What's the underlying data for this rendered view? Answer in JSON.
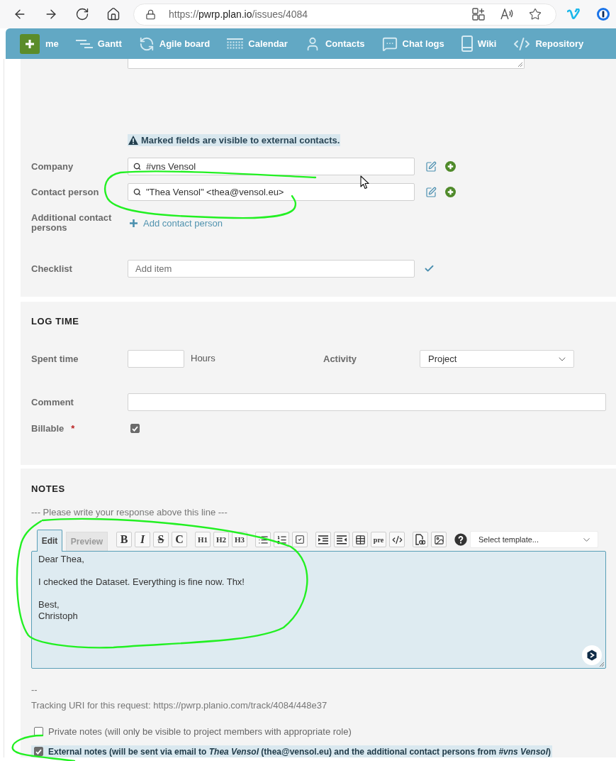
{
  "browser": {
    "address": {
      "scheme": "https://",
      "host": "pwrp.plan.io",
      "path": "/issues/4084"
    }
  },
  "nav": {
    "items": [
      {
        "label": "me",
        "kind": "home"
      },
      {
        "label": "Gantt",
        "kind": "gantt"
      },
      {
        "label": "Agile board",
        "kind": "agile"
      },
      {
        "label": "Calendar",
        "kind": "calendar"
      },
      {
        "label": "Contacts",
        "kind": "contacts"
      },
      {
        "label": "Chat logs",
        "kind": "chat"
      },
      {
        "label": "Wiki",
        "kind": "wiki"
      },
      {
        "label": "Repository",
        "kind": "repository"
      }
    ]
  },
  "contact_panel": {
    "notice": "Marked fields are visible to external contacts.",
    "fields": [
      {
        "kind": "lookup",
        "label": "Company",
        "value": "#vns Vensol"
      },
      {
        "kind": "lookup",
        "label": "Contact person",
        "value": "\"Thea Vensol\" <thea@vensol.eu>"
      },
      {
        "kind": "add",
        "label": "Additional contact persons",
        "link": "Add contact person"
      },
      {
        "kind": "checklist",
        "label": "Checklist",
        "placeholder": "Add item"
      }
    ]
  },
  "log_time": {
    "title": "LOG TIME",
    "spent_time": {
      "label": "Spent time",
      "unit": "Hours"
    },
    "activity": {
      "label": "Activity",
      "value": "Project"
    },
    "comment": {
      "label": "Comment"
    },
    "billable": {
      "label": "Billable",
      "required_mark": "*",
      "checked": true
    }
  },
  "notes": {
    "title": "NOTES",
    "hint": "--- Please write your response above this line ---",
    "tabs": [
      {
        "label": "Edit",
        "selected": true
      },
      {
        "label": "Preview",
        "selected": false
      }
    ],
    "toolbar": [
      {
        "buttons": [
          {
            "kind": "bold",
            "label": "B"
          },
          {
            "kind": "italic",
            "label": "I"
          },
          {
            "kind": "strike",
            "label": "S"
          },
          {
            "kind": "code",
            "label": "C"
          }
        ]
      },
      {
        "buttons": [
          {
            "kind": "heading",
            "label": "H1"
          },
          {
            "kind": "heading",
            "label": "H2"
          },
          {
            "kind": "heading",
            "label": "H3"
          }
        ]
      },
      {
        "buttons": [
          {
            "kind": "bullets"
          },
          {
            "kind": "numbers"
          },
          {
            "kind": "task"
          }
        ]
      },
      {
        "buttons": [
          {
            "kind": "indent"
          },
          {
            "kind": "outdent"
          },
          {
            "kind": "table"
          },
          {
            "kind": "pre",
            "label": "pre"
          },
          {
            "kind": "codeblock"
          }
        ]
      },
      {
        "buttons": [
          {
            "kind": "file"
          },
          {
            "kind": "image"
          }
        ]
      },
      {
        "buttons": [
          {
            "kind": "help"
          }
        ]
      }
    ],
    "template_select": {
      "value": "Select template..."
    },
    "editor": {
      "value": "Dear Thea,\n\nI checked the Dataset. Everything is fine now. Thx!\n\nBest,\nChristoph"
    },
    "signature": "--",
    "tracking": "Tracking URI for this request: https://pwrp.planio.com/track/4084/448e37",
    "options": [
      {
        "label": "Private notes (will only be visible to project members with appropriate role)",
        "checked": false
      },
      {
        "label": "External notes (will be sent via email to *Thea Vensol* (thea@vensol.eu) and the additional contact persons from *#vns Vensol*)",
        "checked": true
      }
    ]
  }
}
